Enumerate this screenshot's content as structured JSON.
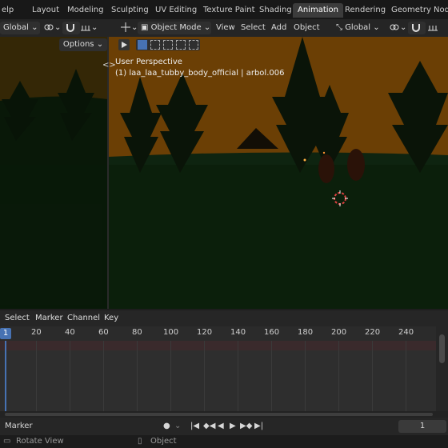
{
  "workspace_tabs": [
    {
      "label": "elp",
      "active": false
    },
    {
      "label": "Layout",
      "active": false
    },
    {
      "label": "Modeling",
      "active": false
    },
    {
      "label": "Sculpting",
      "active": false
    },
    {
      "label": "UV Editing",
      "active": false
    },
    {
      "label": "Texture Paint",
      "active": false
    },
    {
      "label": "Shading",
      "active": false
    },
    {
      "label": "Animation",
      "active": true
    },
    {
      "label": "Rendering",
      "active": false
    },
    {
      "label": "Geometry Nodes",
      "active": false
    }
  ],
  "header": {
    "left_orientation": "Global",
    "options_label": "Options",
    "mode": "Object Mode",
    "menu": [
      "View",
      "Select",
      "Add",
      "Object"
    ],
    "orientation": "Global"
  },
  "viewport": {
    "perspective": "User Perspective",
    "object_info": "(1) laa_laa_tubby_body_official | arbol.006"
  },
  "timeline": {
    "menu": [
      "Select",
      "Marker",
      "Channel",
      "Key"
    ],
    "current_frame_label": "1",
    "ticks": [
      "20",
      "40",
      "60",
      "80",
      "100",
      "120",
      "140",
      "160",
      "180",
      "200",
      "220",
      "240"
    ]
  },
  "playback": {
    "marker_label": "Marker",
    "frame_value": "1"
  },
  "status": {
    "rotate_view": "Rotate View",
    "object": "Object"
  },
  "colors": {
    "accent": "#4772b3",
    "sky": "#6b3f05",
    "ground": "#0b1f0b",
    "cursor_red": "#e04040"
  }
}
